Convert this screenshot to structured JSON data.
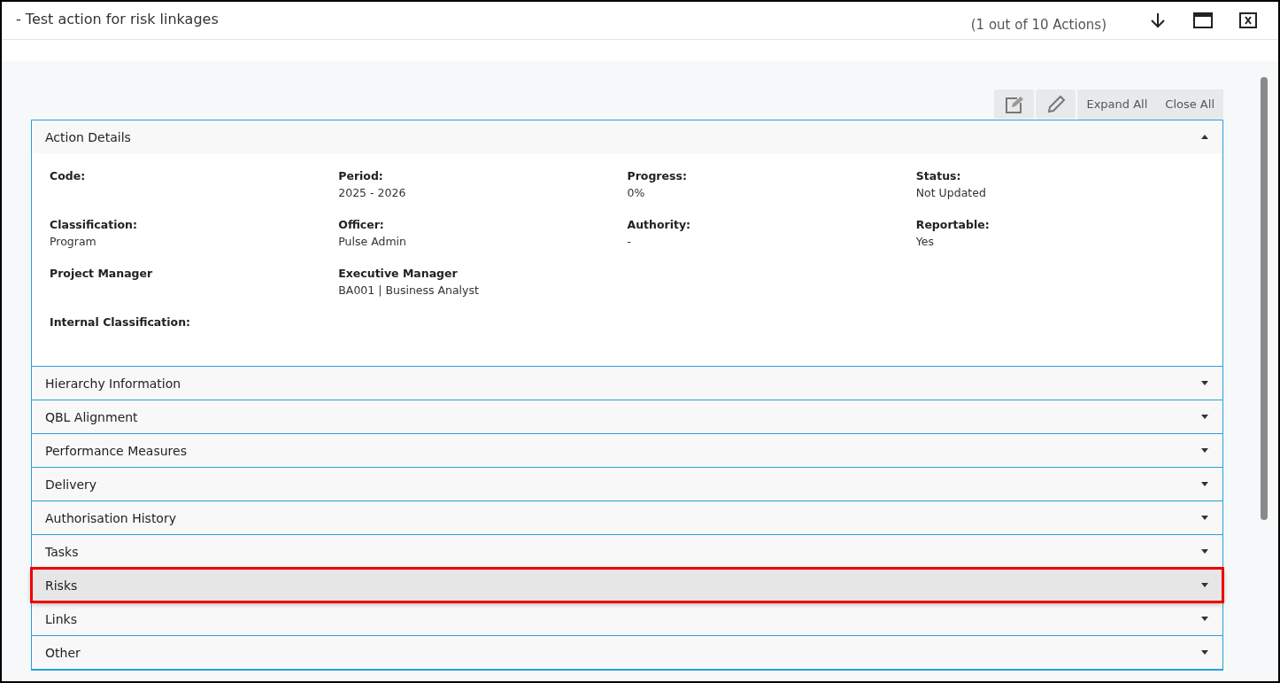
{
  "window": {
    "title": "- Test action for risk linkages",
    "counter": "(1 out of 10 Actions)"
  },
  "toolbar": {
    "buttons": [
      "Expand All",
      "Close All"
    ]
  },
  "sections": [
    {
      "title": "Action Details",
      "expanded": true,
      "highlighted": false,
      "rows": [
        [
          {
            "label": "Code:"
          },
          {
            "label": "Period:",
            "value": "2025 - 2026"
          },
          {
            "label": "Progress:",
            "value": "0%"
          },
          {
            "label": "Status:",
            "value": "Not Updated"
          }
        ],
        [
          {
            "label": "Classification:",
            "value": "Program"
          },
          {
            "label": "Officer:",
            "value": "Pulse Admin"
          },
          {
            "label": "Authority:",
            "value": "-"
          },
          {
            "label": "Reportable:",
            "value": "Yes"
          }
        ],
        [
          {
            "label": "Project Manager"
          },
          {
            "label": "Executive Manager",
            "value": "BA001 | Business Analyst"
          }
        ],
        [
          {
            "label": "Internal Classification:"
          }
        ]
      ]
    },
    {
      "title": "Hierarchy Information",
      "expanded": false,
      "highlighted": false
    },
    {
      "title": "QBL Alignment",
      "expanded": false,
      "highlighted": false
    },
    {
      "title": "Performance Measures",
      "expanded": false,
      "highlighted": false
    },
    {
      "title": "Delivery",
      "expanded": false,
      "highlighted": false
    },
    {
      "title": "Authorisation History",
      "expanded": false,
      "highlighted": false
    },
    {
      "title": "Tasks",
      "expanded": false,
      "highlighted": false
    },
    {
      "title": "Risks",
      "expanded": false,
      "highlighted": true
    },
    {
      "title": "Links",
      "expanded": false,
      "highlighted": false
    },
    {
      "title": "Other",
      "expanded": false,
      "highlighted": false
    }
  ]
}
